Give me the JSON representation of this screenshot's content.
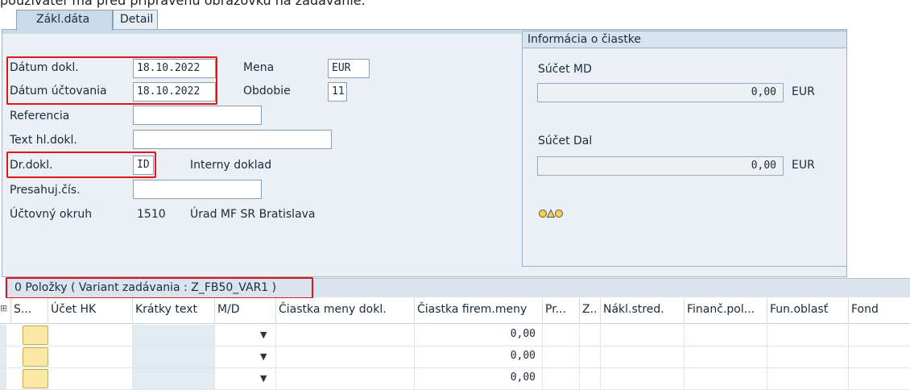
{
  "caption": "používateľ má pred pripravenú obrazovku na zadávanie.",
  "tabs": [
    "Zákl.dáta",
    "Detail"
  ],
  "form": {
    "datum_dokl_label": "Dátum dokl.",
    "datum_dokl_value": "18.10.2022",
    "datum_uct_label": "Dátum účtovania",
    "datum_uct_value": "18.10.2022",
    "mena_label": "Mena",
    "mena_value": "EUR",
    "obdobie_label": "Obdobie",
    "obdobie_value": "11",
    "referencia_label": "Referencia",
    "referencia_value": "",
    "text_label": "Text hl.dokl.",
    "text_value": "",
    "druh_label": "Dr.dokl.",
    "druh_value": "ID",
    "druh_desc": "Interny doklad",
    "presah_label": "Presahuj.čís.",
    "presah_value": "",
    "okruh_label": "Účtovný okruh",
    "okruh_value": "1510",
    "okruh_desc": "Úrad MF SR Bratislava"
  },
  "info": {
    "title": "Informácia o čiastke",
    "md_label": "Súčet MD",
    "md_value": "0,00",
    "md_currency": "EUR",
    "dal_label": "Súčet Dal",
    "dal_value": "0,00",
    "dal_currency": "EUR",
    "status_icon": "traffic-light-icon"
  },
  "table": {
    "title": "0 Položky ( Variant zadávania : Z_FB50_VAR1 )",
    "columns": [
      "S...",
      "Účet HK",
      "Krátky text",
      "M/D",
      "Čiastka meny dokl.",
      "Čiastka firem.meny",
      "Pr...",
      "Z..",
      "Nákl.stred.",
      "Finanč.pol...",
      "Fun.oblasť",
      "Fond"
    ],
    "rows": [
      {
        "amount_firm": "0,00"
      },
      {
        "amount_firm": "0,00"
      },
      {
        "amount_firm": "0,00"
      }
    ]
  },
  "colors": {
    "highlight": "#e0161d",
    "panel": "#eaf0f6",
    "tab_active": "#c9dbe9",
    "select_button": "#fde9a6"
  }
}
